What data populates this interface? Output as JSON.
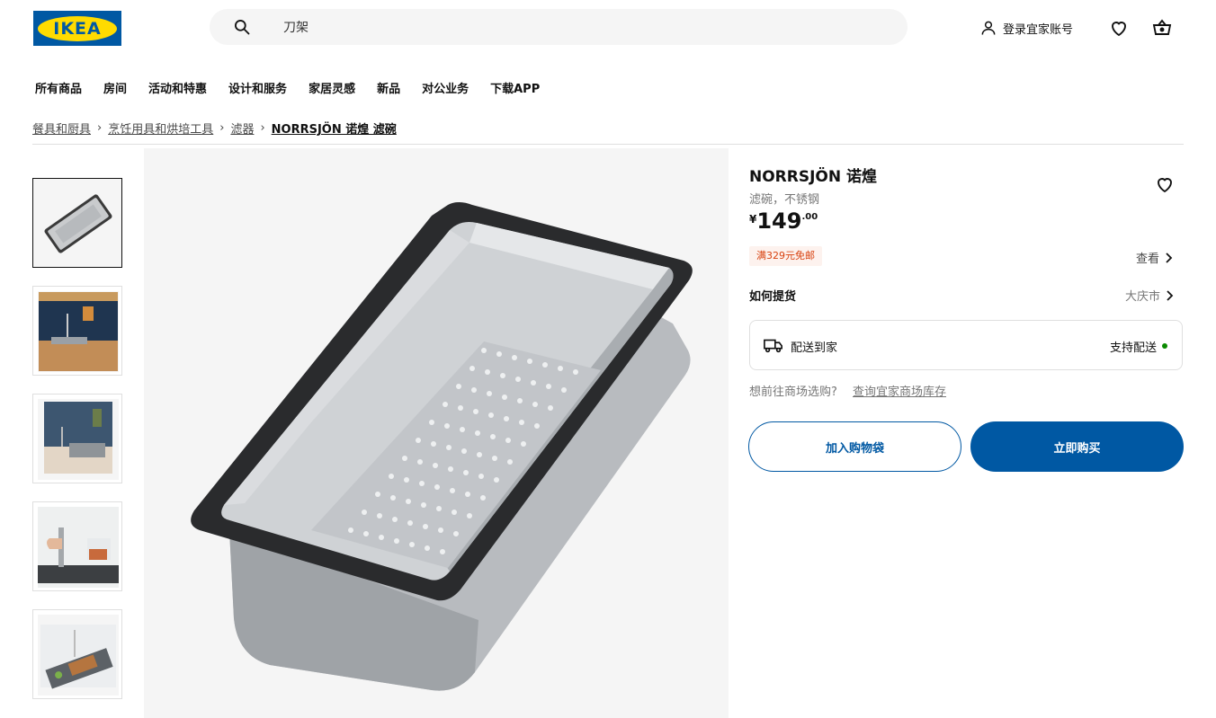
{
  "header": {
    "logo_text": "IKEA",
    "search": {
      "value": "刀架"
    },
    "account_label": "登录宜家账号",
    "icons": [
      "search-icon",
      "person-icon",
      "heart-icon",
      "cart-icon"
    ]
  },
  "nav": {
    "items": [
      "所有商品",
      "房间",
      "活动和特惠",
      "设计和服务",
      "家居灵感",
      "新品",
      "对公业务",
      "下载APP"
    ]
  },
  "breadcrumb": {
    "items": [
      "餐具和厨具",
      "烹饪用具和烘培工具",
      "滤器",
      "NORRSJÖN 诺煌 滤碗"
    ],
    "separator": "›"
  },
  "product": {
    "name": "NORRSJÖN 诺煌",
    "subtitle": "滤碗，不锈钢",
    "price": {
      "currency": "¥",
      "integer": "149",
      "decimal": ".00"
    },
    "promo_badge": "满329元免邮",
    "view_label": "查看",
    "how_to_get_label": "如何提货",
    "city": "大庆市",
    "delivery": {
      "label": "配送到家",
      "status": "支持配送",
      "status_color": "#0a8a00"
    },
    "store_question": "想前往商场选购?",
    "store_link": "查询宜家商场库存",
    "add_to_cart_label": "加入购物袋",
    "buy_now_label": "立即购买",
    "thumbnail_count": 5
  },
  "colors": {
    "brand_blue": "#0058a3",
    "brand_yellow": "#ffdb00",
    "promo_red": "#d8410f"
  }
}
